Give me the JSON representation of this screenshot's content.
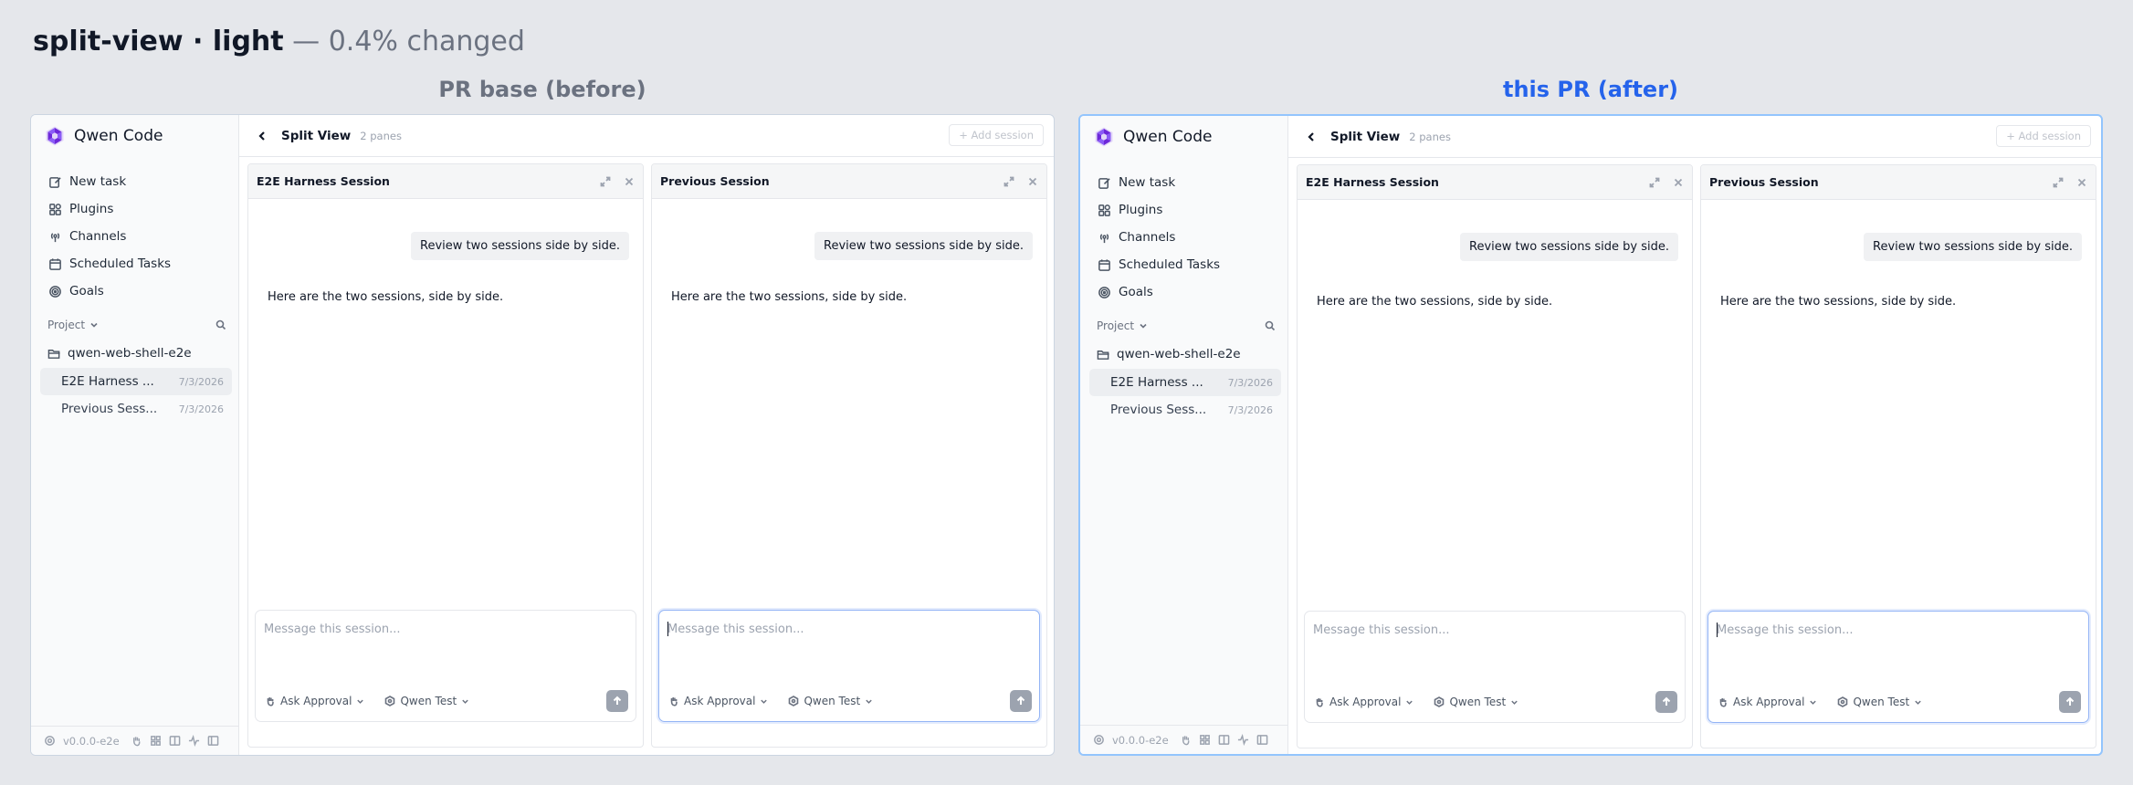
{
  "header": {
    "title_strong": "split-view · light",
    "title_muted": " — 0.4% changed"
  },
  "columns": {
    "before_label": "PR base (before)",
    "after_label": "this PR (after)"
  },
  "app": {
    "brand": "Qwen Code",
    "nav": [
      {
        "label": "New task",
        "icon": "edit-icon"
      },
      {
        "label": "Plugins",
        "icon": "puzzle-icon"
      },
      {
        "label": "Channels",
        "icon": "broadcast-icon"
      },
      {
        "label": "Scheduled Tasks",
        "icon": "calendar-clock-icon"
      },
      {
        "label": "Goals",
        "icon": "target-icon"
      }
    ],
    "project_label": "Project",
    "folder": "qwen-web-shell-e2e",
    "sessions": [
      {
        "label": "E2E Harness ...",
        "date": "7/3/2026"
      },
      {
        "label": "Previous Sess...",
        "date": "7/3/2026"
      }
    ],
    "version": "v0.0.0-e2e",
    "topbar": {
      "back_icon": "chevron-left-icon",
      "title": "Split View",
      "subtitle": "2 panes",
      "add_session": "+ Add session"
    },
    "panes": [
      {
        "title": "E2E Harness Session",
        "user_message": "Review two sessions side by side.",
        "assistant_message": "Here are the two sessions, side by side.",
        "placeholder": "Message this session...",
        "approval": "Ask Approval",
        "model": "Qwen Test"
      },
      {
        "title": "Previous Session",
        "user_message": "Review two sessions side by side.",
        "assistant_message": "Here are the two sessions, side by side.",
        "placeholder": "Message this session...",
        "approval": "Ask Approval",
        "model": "Qwen Test"
      }
    ]
  },
  "colors": {
    "before_label": "#6b7280",
    "after_label": "#2563eb",
    "after_frame_border": "#93c5fd",
    "focus_ring": "#93b4f5"
  }
}
